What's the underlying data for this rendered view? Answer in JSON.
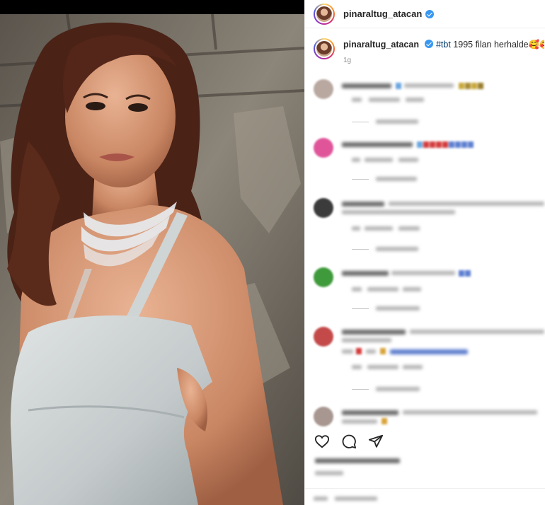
{
  "post": {
    "username": "pinaraltug_atacan",
    "caption_username": "pinaraltug_atacan",
    "caption_hashtag": "#tbt",
    "caption_text": " 1995 filan herhalde",
    "caption_emojis": "🥰🥰🥰",
    "time": "1g",
    "verified_color": "#3897f0"
  },
  "photo": {
    "subject": "portrait-photo",
    "dress_color": "#c9cfd0",
    "hair_color": "#4a2216",
    "wall_color": "#6e6a62"
  },
  "actions": [
    "heart-icon",
    "comment-icon",
    "share-icon"
  ],
  "comments_blurred": true
}
